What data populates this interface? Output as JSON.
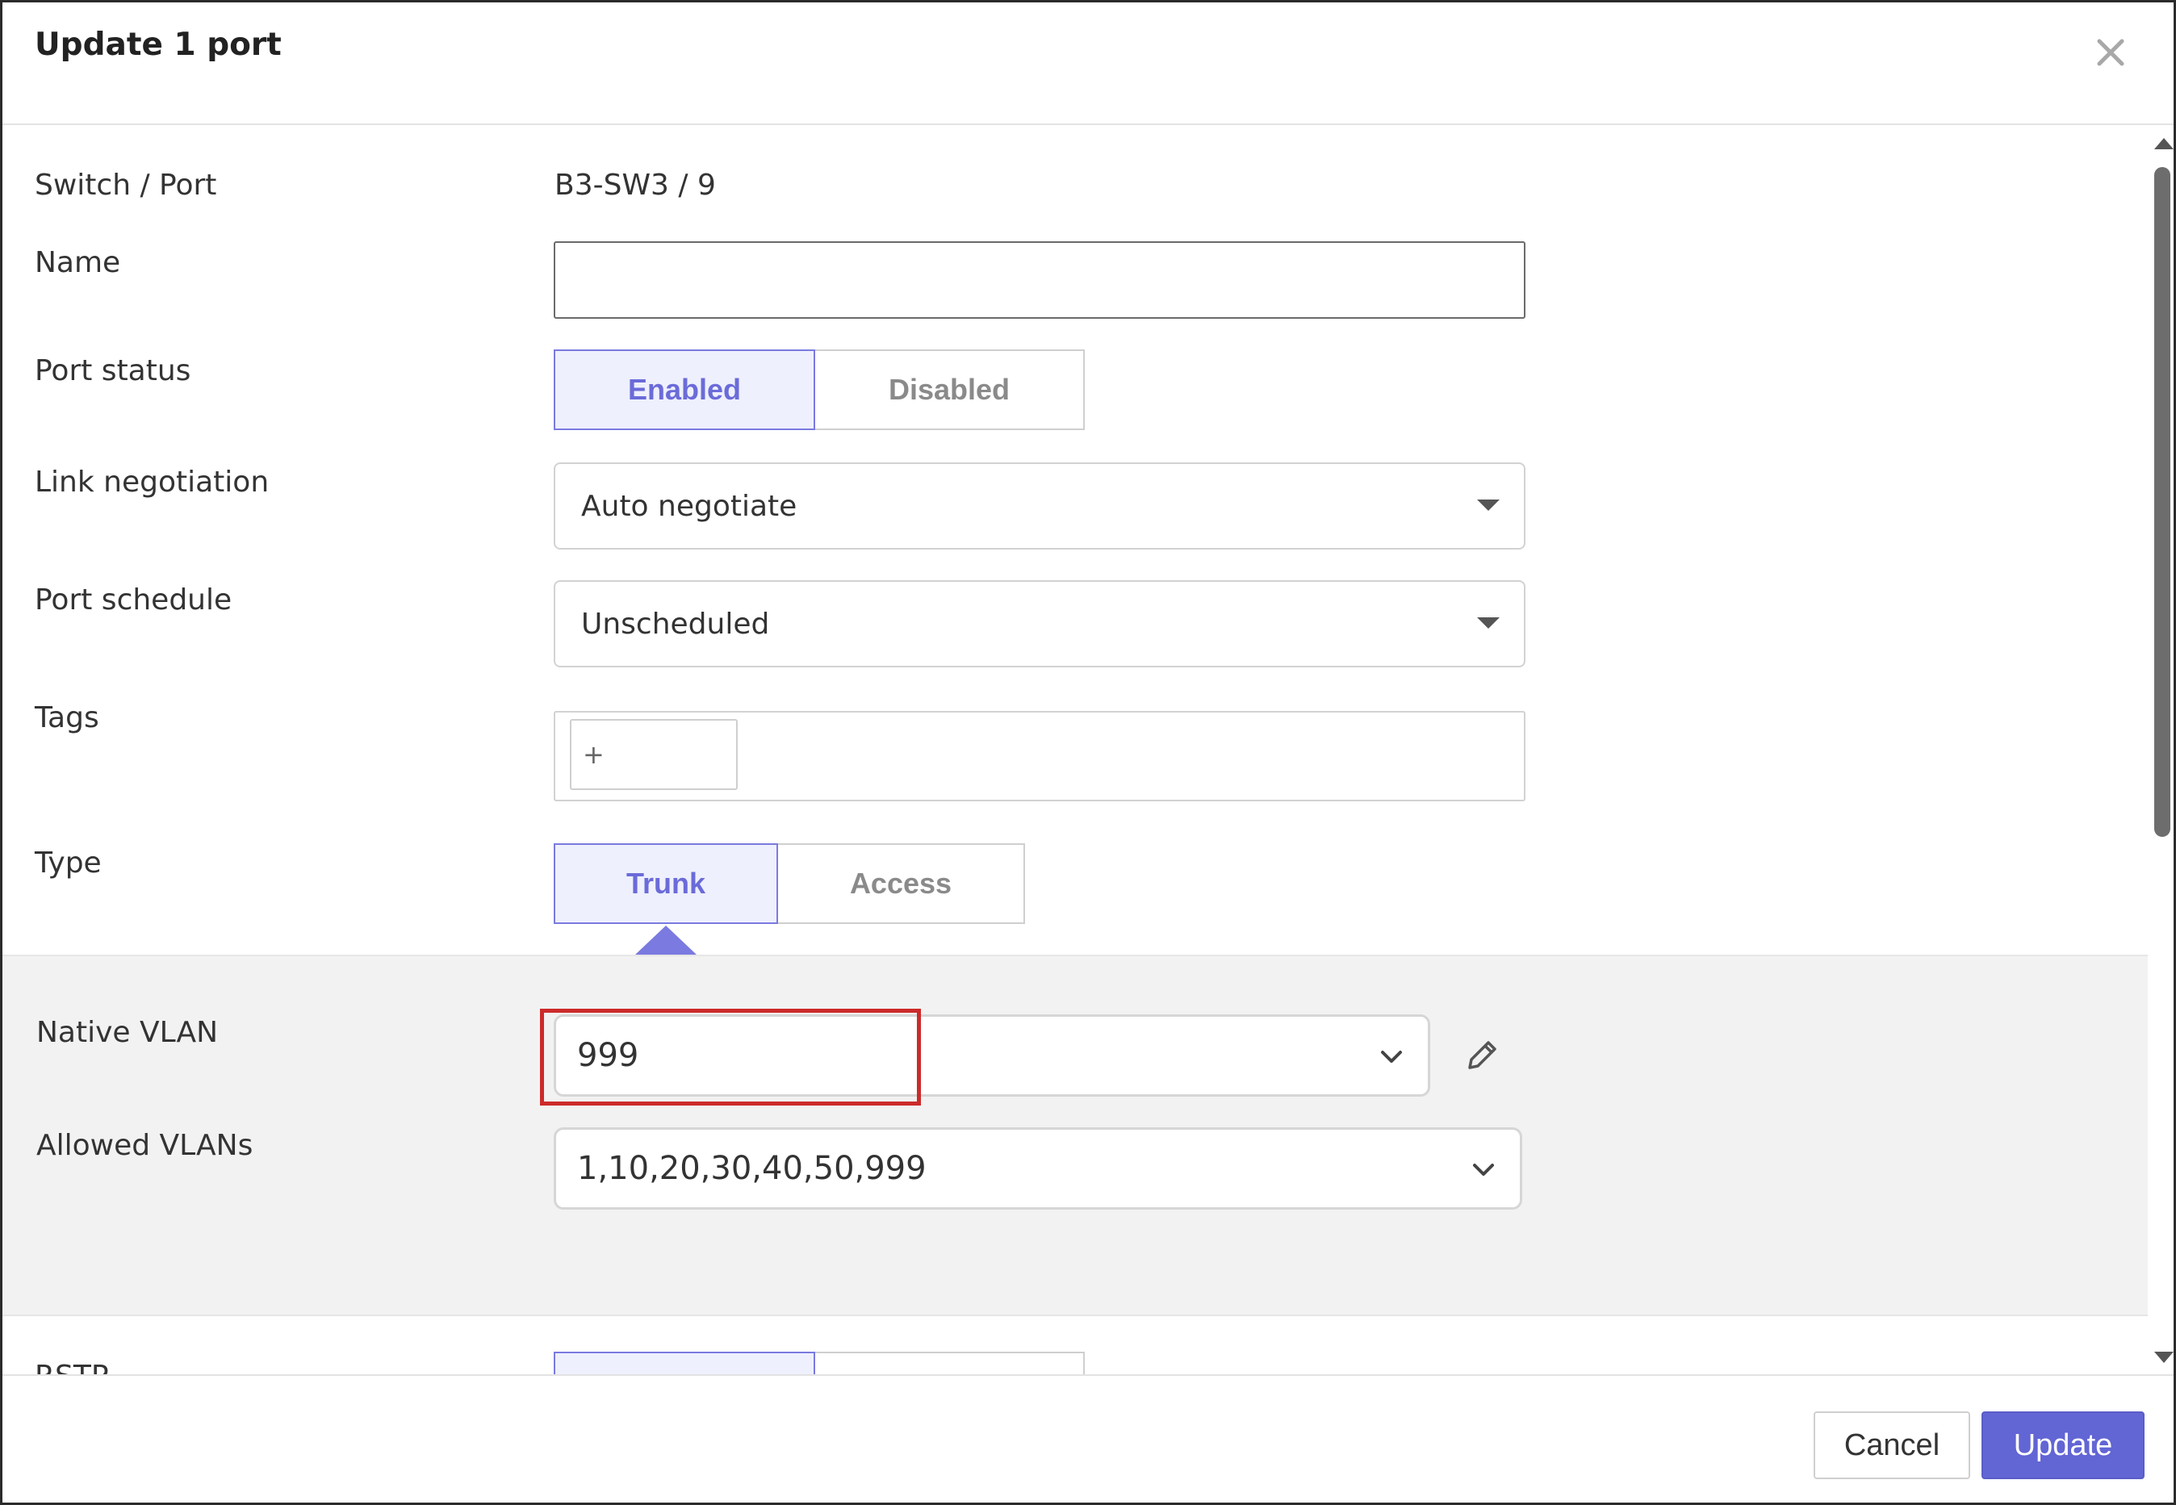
{
  "dialog": {
    "title": "Update 1 port"
  },
  "fields": {
    "switch_port": {
      "label": "Switch / Port",
      "value": "B3-SW3 / 9"
    },
    "name": {
      "label": "Name",
      "value": ""
    },
    "port_status": {
      "label": "Port status",
      "options": [
        "Enabled",
        "Disabled"
      ],
      "selected": "Enabled"
    },
    "link_negotiation": {
      "label": "Link negotiation",
      "value": "Auto negotiate"
    },
    "port_schedule": {
      "label": "Port schedule",
      "value": "Unscheduled"
    },
    "tags": {
      "label": "Tags",
      "add_label": "+"
    },
    "type": {
      "label": "Type",
      "options": [
        "Trunk",
        "Access"
      ],
      "selected": "Trunk"
    },
    "native_vlan": {
      "label": "Native VLAN",
      "value": "999"
    },
    "allowed_vlans": {
      "label": "Allowed VLANs",
      "value": "1,10,20,30,40,50,999"
    },
    "rstp": {
      "label": "RSTP"
    }
  },
  "footer": {
    "cancel_label": "Cancel",
    "update_label": "Update"
  },
  "colors": {
    "accent": "#6265d4",
    "active_segment_text": "#6b6bd9",
    "active_segment_bg": "#eef0fd",
    "highlight_border": "#cc2a2a",
    "panel_bg": "#f2f2f2"
  },
  "icons": {
    "close": "close-icon",
    "dropdown": "caret-down-icon",
    "chevron": "chevron-down-icon",
    "edit": "pencil-icon"
  }
}
